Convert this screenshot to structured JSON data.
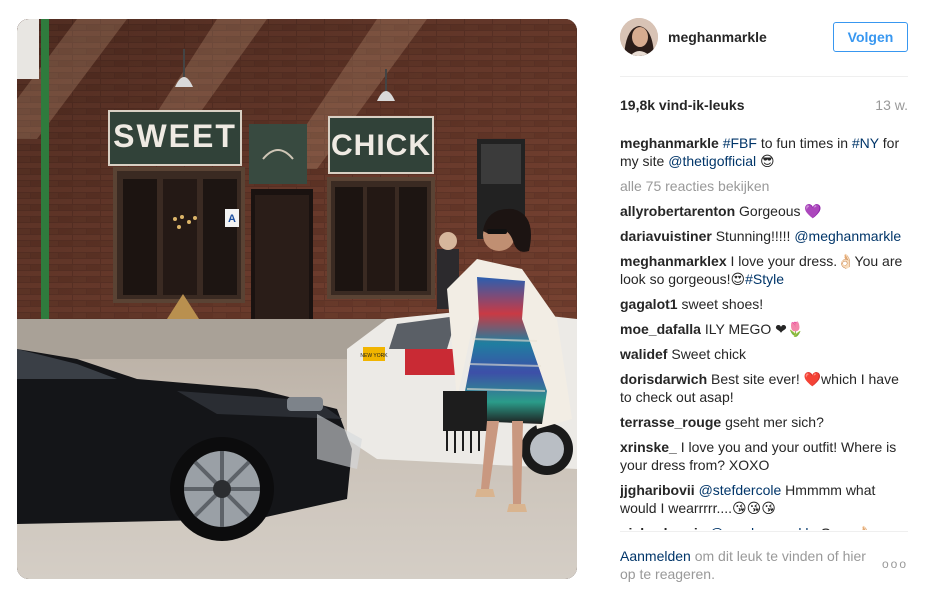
{
  "post": {
    "username": "meghanmarkle",
    "follow_label": "Volgen",
    "likes": "19,8k vind-ik-leuks",
    "age": "13 w.",
    "view_all": "alle 75 reacties bekijken",
    "photo_signs": {
      "sweet": "SWEET",
      "chick": "CHICK",
      "plate": "NEW YORK"
    },
    "caption": {
      "author": "meghanmarkle",
      "parts": [
        {
          "t": "#FBF",
          "tag": true
        },
        {
          "t": " to fun times in ",
          "tag": false
        },
        {
          "t": "#NY",
          "tag": true
        },
        {
          "t": " for my site ",
          "tag": false
        },
        {
          "t": "@thetigofficial",
          "tag": true
        },
        {
          "t": " 😎",
          "tag": false
        }
      ]
    },
    "comments": [
      {
        "author": "allyrobertarenton",
        "parts": [
          {
            "t": "Gorgeous 💜",
            "tag": false
          }
        ]
      },
      {
        "author": "dariavuistiner",
        "parts": [
          {
            "t": "Stunning!!!!! ",
            "tag": false
          },
          {
            "t": "@meghanmarkle",
            "tag": true
          }
        ]
      },
      {
        "author": "meghanmarklex",
        "parts": [
          {
            "t": "I love your dress.👌🏻You are look so gorgeous!😍",
            "tag": false
          },
          {
            "t": "#Style",
            "tag": true
          }
        ]
      },
      {
        "author": "gagalot1",
        "parts": [
          {
            "t": "sweet shoes!",
            "tag": false
          }
        ]
      },
      {
        "author": "moe_dafalla",
        "parts": [
          {
            "t": "ILY MEGO ❤🌷",
            "tag": false
          }
        ]
      },
      {
        "author": "walidef",
        "parts": [
          {
            "t": "Sweet chick",
            "tag": false
          }
        ]
      },
      {
        "author": "dorisdarwich",
        "parts": [
          {
            "t": "Best site ever! ❤️which I have to check out asap!",
            "tag": false
          }
        ]
      },
      {
        "author": "terrasse_rouge",
        "parts": [
          {
            "t": "gseht mer sich?",
            "tag": false
          }
        ]
      },
      {
        "author": "xrinske_",
        "parts": [
          {
            "t": "I love you and your outfit! Where is your dress from? XOXO",
            "tag": false
          }
        ]
      },
      {
        "author": "jjgharibovii",
        "parts": [
          {
            "t": "@stefdercole",
            "tag": true
          },
          {
            "t": " Hmmmm what would I wearrrrr....😘😘😘",
            "tag": false
          }
        ]
      },
      {
        "author": "nicky_burais",
        "parts": [
          {
            "t": "@meghanmarkle",
            "tag": true
          },
          {
            "t": " Gorg 👌🏻",
            "tag": false
          }
        ]
      }
    ],
    "footer": {
      "login_link": "Aanmelden",
      "rest": " om dit leuk te vinden of hier op te reageren.",
      "more": "ooo"
    }
  },
  "colors": {
    "link": "#003569",
    "follow": "#3897f0",
    "muted": "#999999"
  }
}
